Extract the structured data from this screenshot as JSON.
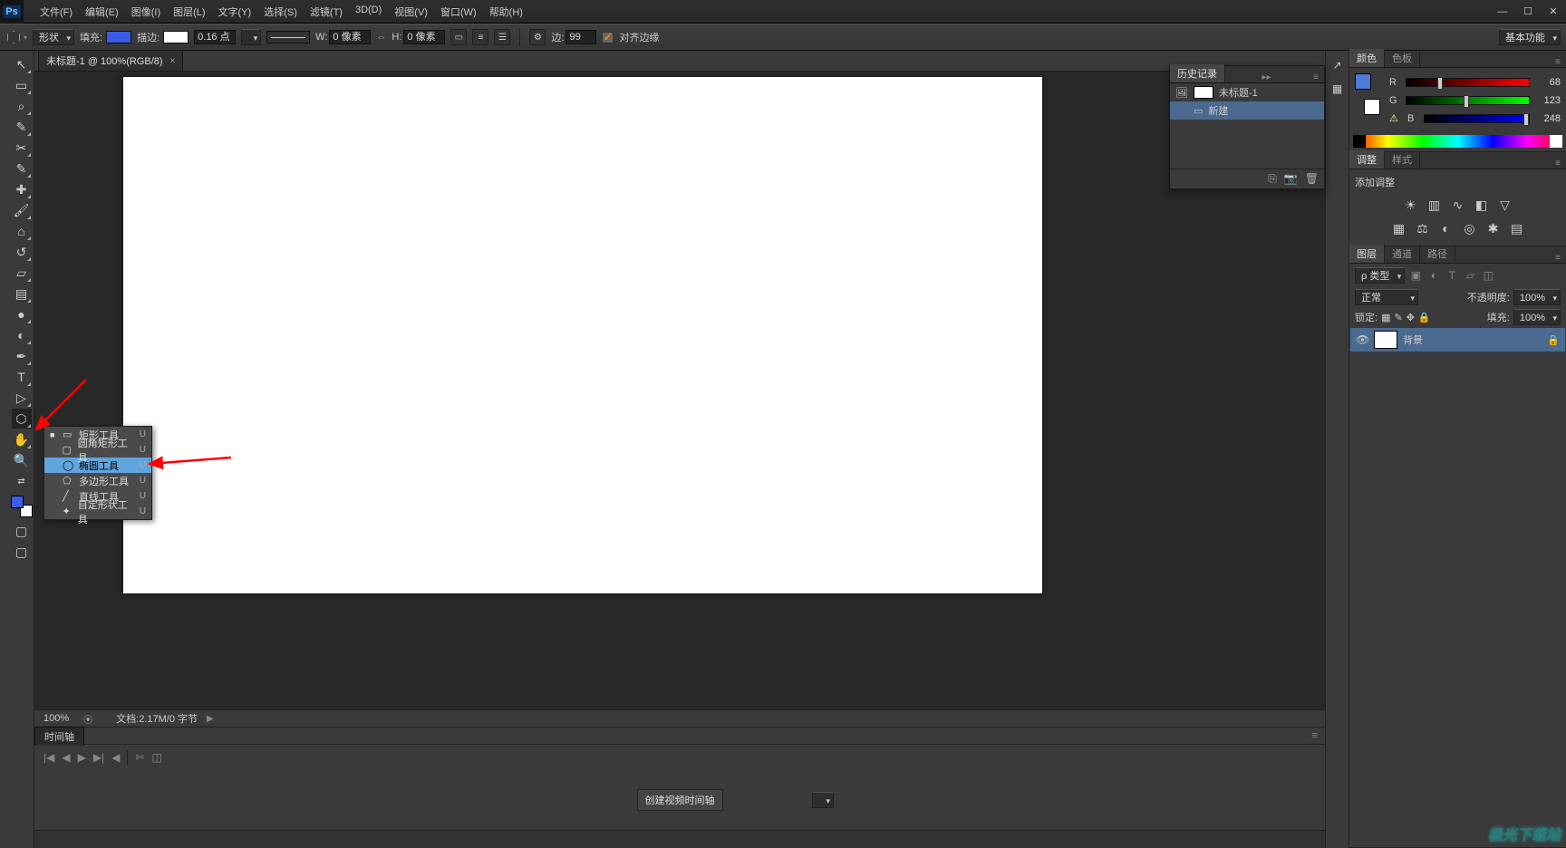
{
  "titlebar": {
    "logo": "Ps",
    "menu": [
      "文件(F)",
      "编辑(E)",
      "图像(I)",
      "图层(L)",
      "文字(Y)",
      "选择(S)",
      "滤镜(T)",
      "3D(D)",
      "视图(V)",
      "窗口(W)",
      "帮助(H)"
    ]
  },
  "options": {
    "mode_label": "形状",
    "fill_label": "填充:",
    "stroke_label": "描边:",
    "stroke_width": "0.16 点",
    "w_label": "W:",
    "w_val": "0 像素",
    "h_label": "H:",
    "h_val": "0 像素",
    "sides_label": "边:",
    "sides_val": "99",
    "align_edges": "对齐边缘",
    "workspace": "基本功能"
  },
  "document": {
    "tab": "未标题-1 @ 100%(RGB/8)"
  },
  "status": {
    "zoom": "100%",
    "doc": "文档:2.17M/0 字节"
  },
  "timeline": {
    "tab": "时间轴",
    "button": "创建视频时间轴"
  },
  "flyout": {
    "items": [
      {
        "label": "矩形工具",
        "sc": "U"
      },
      {
        "label": "圆角矩形工具",
        "sc": "U"
      },
      {
        "label": "椭圆工具",
        "sc": "U"
      },
      {
        "label": "多边形工具",
        "sc": "U"
      },
      {
        "label": "直线工具",
        "sc": "U"
      },
      {
        "label": "自定形状工具",
        "sc": "U"
      }
    ],
    "selected_index": 2
  },
  "history": {
    "tab": "历史记录",
    "doc": "未标题-1",
    "items": [
      "新建"
    ]
  },
  "color_panel": {
    "tab_color": "颜色",
    "tab_swatches": "色板",
    "r": 68,
    "g": 123,
    "b": 248
  },
  "adjust": {
    "tab_adjust": "调整",
    "tab_styles": "样式",
    "heading": "添加调整"
  },
  "layers": {
    "tab_layers": "图层",
    "tab_channels": "通道",
    "tab_paths": "路径",
    "filter": "ρ 类型",
    "blend": "正常",
    "opacity_label": "不透明度:",
    "opacity": "100%",
    "fill_label": "填充:",
    "fill": "100%",
    "lock_label": "锁定:",
    "items": [
      {
        "name": "背景"
      }
    ]
  },
  "watermark": "极光下载站"
}
